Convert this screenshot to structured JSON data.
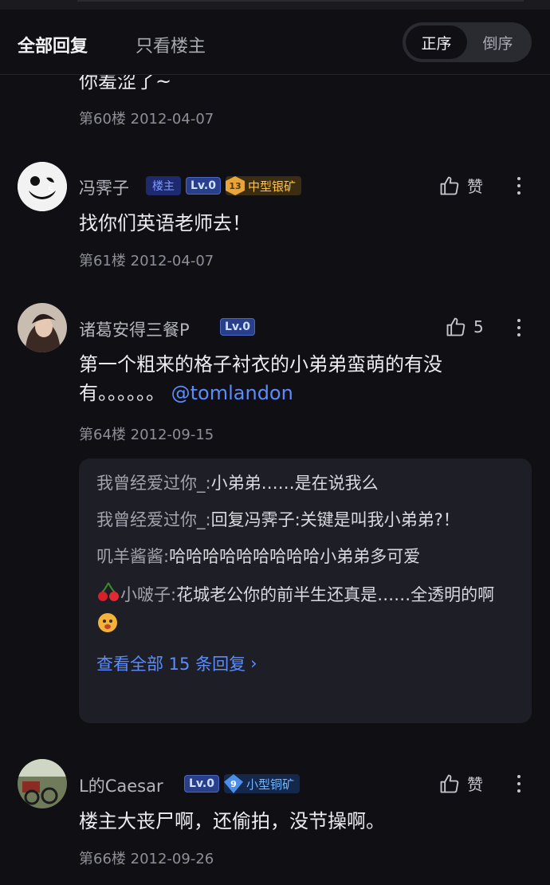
{
  "tabs": {
    "all": "全部回复",
    "op_only": "只看楼主"
  },
  "sort": {
    "asc": "正序",
    "desc": "倒序"
  },
  "partial_post": {
    "text": "你羞涩了~",
    "floor_date": "第60楼 2012-04-07"
  },
  "posts": [
    {
      "username": "冯霁子",
      "owner_badge": "楼主",
      "level": "Lv.0",
      "mine_num": "13",
      "mine_label": "中型银矿",
      "like": "赞",
      "text": "找你们英语老师去！",
      "floor_date": "第61楼 2012-04-07"
    },
    {
      "username": "诸葛安得三餐P",
      "level": "Lv.0",
      "like": "5",
      "text": "第一个粗来的格子衬衣的小弟弟蛮萌的有没有。。。。。。",
      "mention": "@tomlandon",
      "floor_date": "第64楼 2012-09-15"
    },
    {
      "username": "L的Caesar",
      "level": "Lv.0",
      "mine_num": "9",
      "mine_label": "小型铜矿",
      "like": "赞",
      "text": "楼主大丧尸啊，还偷拍，没节操啊。",
      "floor_date": "第66楼 2012-09-26"
    }
  ],
  "replies": [
    {
      "name": "我曾经爱过你_:",
      "text": "小弟弟……是在说我么"
    },
    {
      "name": "我曾经爱过你_:",
      "text": "回复冯霁子:关键是叫我小弟弟?！"
    },
    {
      "name": "叽羊酱酱:",
      "text": "哈哈哈哈哈哈哈哈哈小弟弟多可爱"
    },
    {
      "name": "小啵子:",
      "text": "花城老公你的前半生还真是……全透明的啊"
    }
  ],
  "more_replies": "查看全部 15 条回复",
  "colors": {
    "accent": "#5b8cff",
    "background": "#101014",
    "reply_box": "#1e1f26"
  }
}
